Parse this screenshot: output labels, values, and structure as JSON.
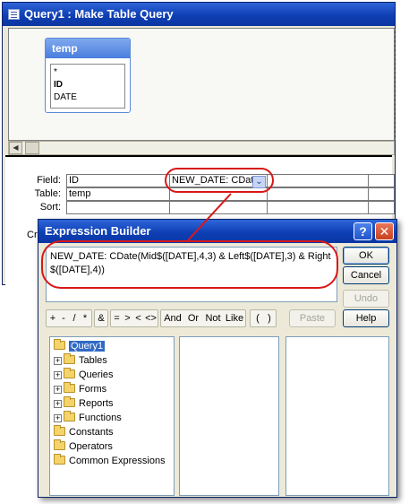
{
  "query_window": {
    "title": "Query1 : Make Table Query",
    "table_box": {
      "title": "temp",
      "fields": [
        "*",
        "ID",
        "DATE"
      ]
    },
    "grid": {
      "row_labels": {
        "field": "Field:",
        "table": "Table:",
        "sort": "Sort:",
        "criteria_partial": "Cr"
      },
      "col1": {
        "field": "ID",
        "table": "temp"
      },
      "col2": {
        "field": "NEW_DATE: CDat"
      }
    }
  },
  "expression_builder": {
    "title": "Expression Builder",
    "title_buttons": {
      "help": "?",
      "close": "✕"
    },
    "expression_line1": "NEW_DATE: CDate(Mid$([DATE],4,3) & Left$([DATE],3) & Right",
    "expression_line2": "$([DATE],4))",
    "buttons": {
      "ok": "OK",
      "cancel": "Cancel",
      "undo": "Undo",
      "paste": "Paste",
      "help": "Help"
    },
    "operators_a": [
      "+",
      "-",
      "/",
      "*"
    ],
    "operators_b": [
      "&"
    ],
    "operators_c": [
      "=",
      ">",
      "<",
      "<>"
    ],
    "operators_d": [
      "And",
      "Or",
      "Not",
      "Like"
    ],
    "operators_e": [
      "(",
      ")"
    ],
    "tree": [
      {
        "label": "Query1",
        "expandable": false,
        "selected": true
      },
      {
        "label": "Tables",
        "expandable": true,
        "selected": false
      },
      {
        "label": "Queries",
        "expandable": true,
        "selected": false
      },
      {
        "label": "Forms",
        "expandable": true,
        "selected": false
      },
      {
        "label": "Reports",
        "expandable": true,
        "selected": false
      },
      {
        "label": "Functions",
        "expandable": true,
        "selected": false
      },
      {
        "label": "Constants",
        "expandable": false,
        "selected": false
      },
      {
        "label": "Operators",
        "expandable": false,
        "selected": false
      },
      {
        "label": "Common Expressions",
        "expandable": false,
        "selected": false
      }
    ]
  },
  "icons": {
    "query_app": "query-window-icon",
    "scroll_left": "scroll-left-arrow-icon",
    "combo_arrow": "chevron-down-icon",
    "folder": "folder-icon",
    "expand": "plus-expand-icon"
  },
  "colors": {
    "titlebar_blue": "#0f3fb4",
    "window_bg": "#ece9d8",
    "annotation_red": "#d81818",
    "selection": "#316ac5"
  }
}
